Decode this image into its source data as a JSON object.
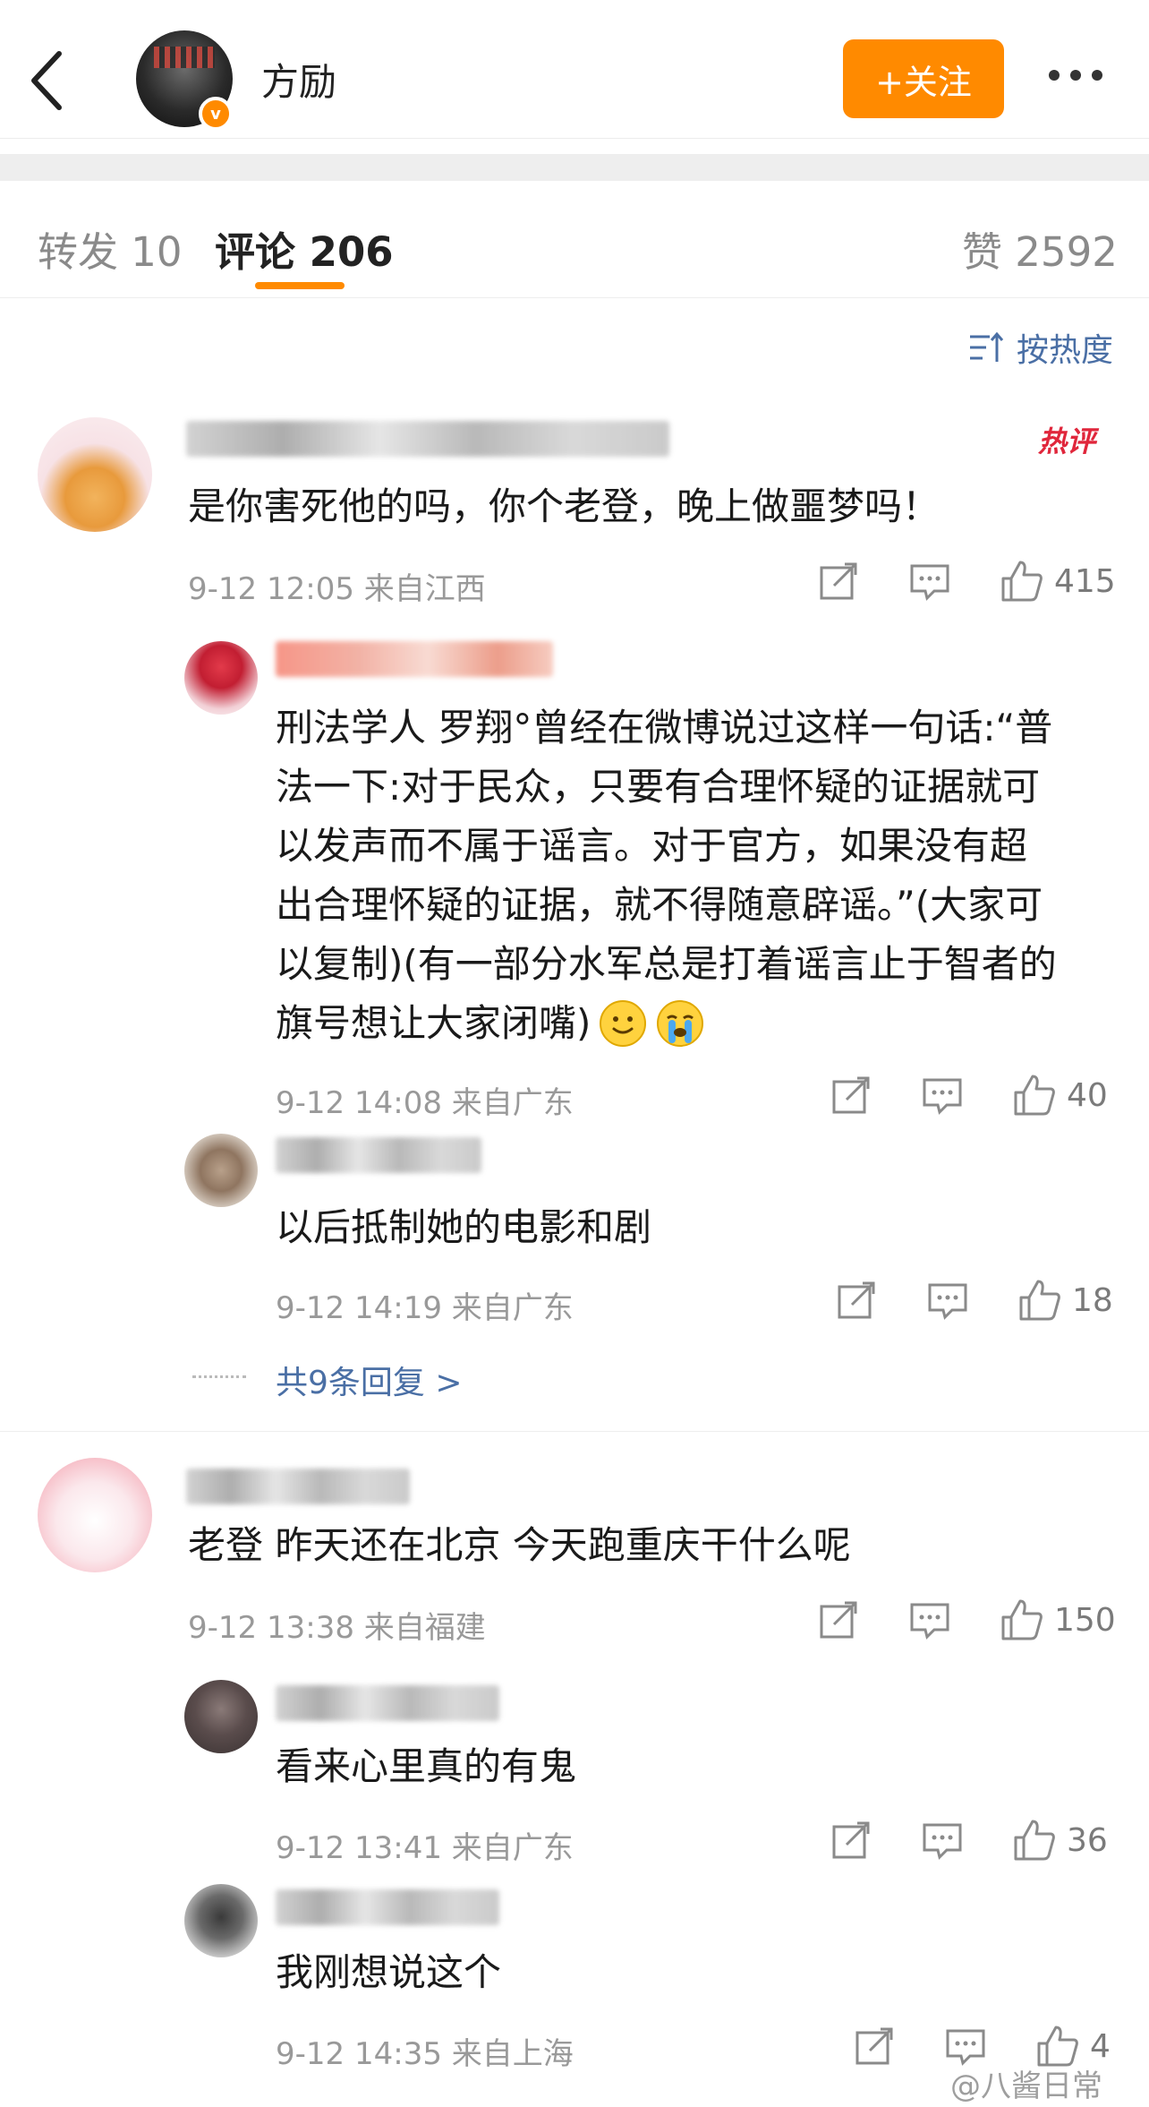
{
  "header": {
    "username": "方励",
    "follow_label": "+关注"
  },
  "tabs": {
    "repost": "转发 10",
    "comments": "评论 206",
    "likes": "赞 2592"
  },
  "sort_label": "按热度",
  "hot_label": "热评",
  "comments": [
    {
      "text": "是你害死他的吗，你个老登，晚上做噩梦吗！",
      "meta": "9-12 12:05 来自江西",
      "likes": "415",
      "replies": [
        {
          "text_lines": [
            "刑法学人 罗翔°曾经在微博说过这样一句话:“普",
            "法一下:对于民众，只要有合理怀疑的证据就可",
            "以发声而不属于谣言。对于官方，如果没有超",
            "出合理怀疑的证据，就不得随意辟谣。”(大家可",
            "以复制)(有一部分水军总是打着谣言止于智者的",
            "旗号想让大家闭嘴)"
          ],
          "meta": "9-12 14:08 来自广东",
          "likes": "40"
        },
        {
          "text": "以后抵制她的电影和剧",
          "meta": "9-12 14:19 来自广东",
          "likes": "18"
        }
      ],
      "more_replies": "共9条回复 >"
    },
    {
      "text": "老登 昨天还在北京 今天跑重庆干什么呢",
      "meta": "9-12 13:38 来自福建",
      "likes": "150",
      "replies": [
        {
          "text": "看来心里真的有鬼",
          "meta": "9-12 13:41 来自广东",
          "likes": "36"
        },
        {
          "text": "我刚想说这个",
          "meta": "9-12 14:35 来自上海",
          "likes": "4"
        }
      ]
    }
  ],
  "watermark": "@八酱日常",
  "colors": {
    "accent": "#ff8a00",
    "link": "#4a6fa5",
    "hot": "#e0263b"
  }
}
